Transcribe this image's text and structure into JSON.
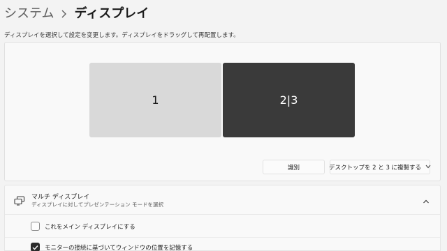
{
  "breadcrumb": {
    "parent": "システム",
    "separator_icon": "chevron-right-icon",
    "current": "ディスプレイ"
  },
  "instruction": "ディスプレイを選択して設定を変更します。ディスプレイをドラッグして再配置します。",
  "monitors": [
    {
      "label": "1",
      "selected": false
    },
    {
      "label": "2|3",
      "selected": true
    }
  ],
  "buttons": {
    "identify": "識別",
    "duplicate": "デスクトップを 2 と 3 に複製する"
  },
  "multi_display": {
    "icon": "multi-monitor-icon",
    "title": "マルチ ディスプレイ",
    "subtitle": "ディスプレイに対してプレゼンテーション モードを選択",
    "expanded": true,
    "options": [
      {
        "label": "これをメイン ディスプレイにする",
        "checked": false
      },
      {
        "label": "モニターの接続に基づいてウィンドウの位置を記憶する",
        "checked": true
      }
    ]
  },
  "colors": {
    "background": "#f3f3f3",
    "monitor_unselected": "#d9d9d9",
    "monitor_selected": "#3a3a3a"
  }
}
